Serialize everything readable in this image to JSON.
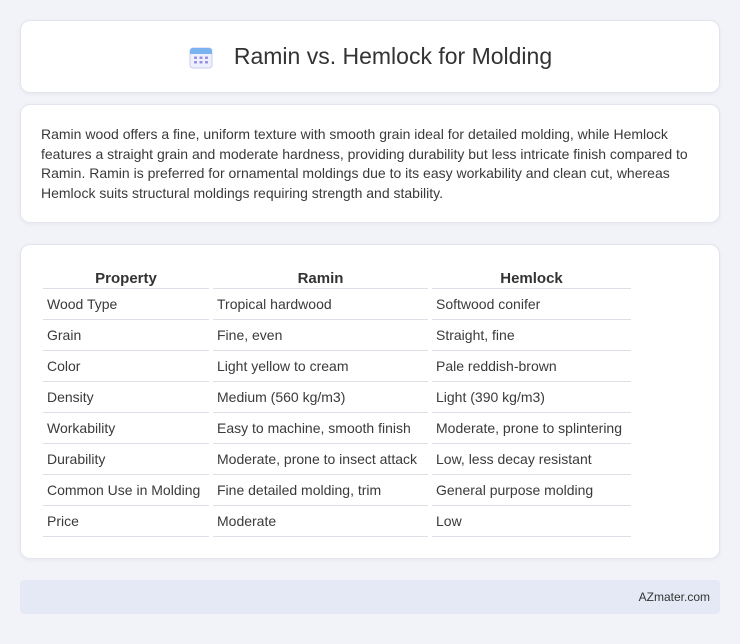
{
  "header": {
    "title": "Ramin vs. Hemlock for Molding",
    "icon": "calendar-icon"
  },
  "intro": {
    "text": "Ramin wood offers a fine, uniform texture with smooth grain ideal for detailed molding, while Hemlock features a straight grain and moderate hardness, providing durability but less intricate finish compared to Ramin. Ramin is preferred for ornamental moldings due to its easy workability and clean cut, whereas Hemlock suits structural moldings requiring strength and stability."
  },
  "table": {
    "headers": [
      "Property",
      "Ramin",
      "Hemlock"
    ],
    "rows": [
      [
        "Wood Type",
        "Tropical hardwood",
        "Softwood conifer"
      ],
      [
        "Grain",
        "Fine, even",
        "Straight, fine"
      ],
      [
        "Color",
        "Light yellow to cream",
        "Pale reddish-brown"
      ],
      [
        "Density",
        "Medium (560 kg/m3)",
        "Light (390 kg/m3)"
      ],
      [
        "Workability",
        "Easy to machine, smooth finish",
        "Moderate, prone to splintering"
      ],
      [
        "Durability",
        "Moderate, prone to insect attack",
        "Low, less decay resistant"
      ],
      [
        "Common Use in Molding",
        "Fine detailed molding, trim",
        "General purpose molding"
      ],
      [
        "Price",
        "Moderate",
        "Low"
      ]
    ]
  },
  "footer": {
    "brand": "AZmater.com"
  },
  "colors": {
    "background": "#f1f3f9",
    "card": "#ffffff",
    "footer": "#e4e9f5",
    "icon_accent": "#8a7fe8"
  }
}
